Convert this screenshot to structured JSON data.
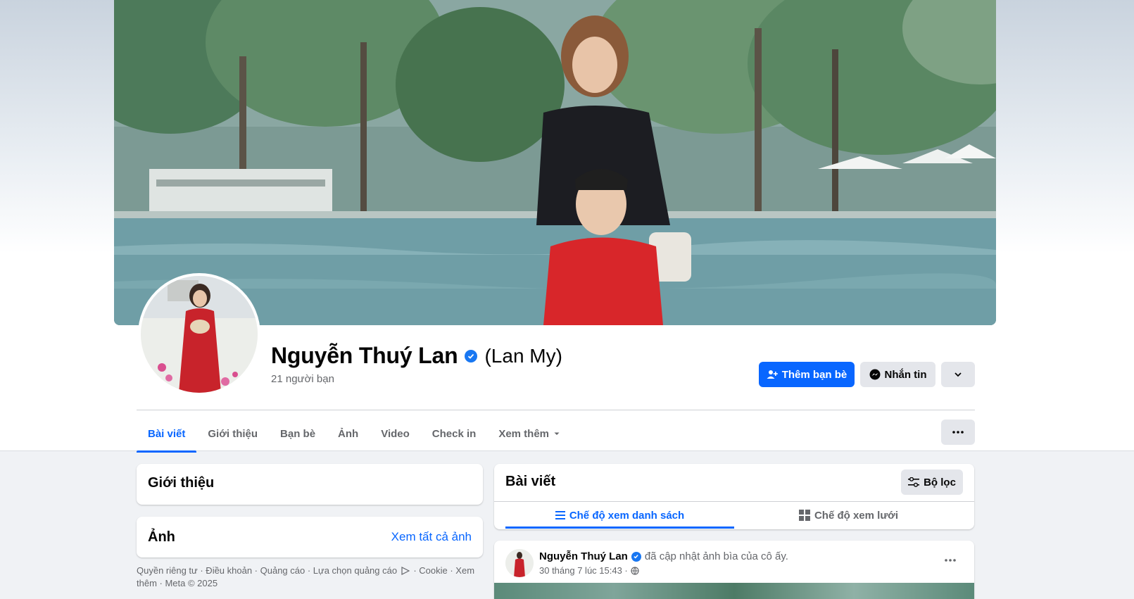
{
  "profile": {
    "name": "Nguyễn Thuý Lan",
    "alt_name": "(Lan My)",
    "friends_count": "21 người bạn",
    "verified": true
  },
  "actions": {
    "add_friend": "Thêm bạn bè",
    "message": "Nhắn tin"
  },
  "tabs": [
    {
      "label": "Bài viết",
      "active": true
    },
    {
      "label": "Giới thiệu",
      "active": false
    },
    {
      "label": "Bạn bè",
      "active": false
    },
    {
      "label": "Ảnh",
      "active": false
    },
    {
      "label": "Video",
      "active": false
    },
    {
      "label": "Check in",
      "active": false
    },
    {
      "label": "Xem thêm",
      "active": false
    }
  ],
  "intro": {
    "title": "Giới thiệu"
  },
  "photos": {
    "title": "Ảnh",
    "see_all": "Xem tất cả ảnh"
  },
  "footer": {
    "links": "Quyền riêng tư · Điều khoản · Quảng cáo · Lựa chọn quảng cáo",
    "links_2": "· Cookie · Xem",
    "links_3": "thêm · Meta © 2025"
  },
  "posts": {
    "title": "Bài viết",
    "filter": "Bộ lọc",
    "list_view": "Chế độ xem danh sách",
    "grid_view": "Chế độ xem lưới"
  },
  "post": {
    "author": "Nguyễn Thuý Lan",
    "action": "đã cập nhật ảnh bìa của cô ấy.",
    "time": "30 tháng 7 lúc 15:43 ·"
  },
  "colors": {
    "accent": "#0866ff",
    "page_bg": "#f0f2f5",
    "secondary_button": "#e4e6eb",
    "muted_text": "#65676b"
  }
}
